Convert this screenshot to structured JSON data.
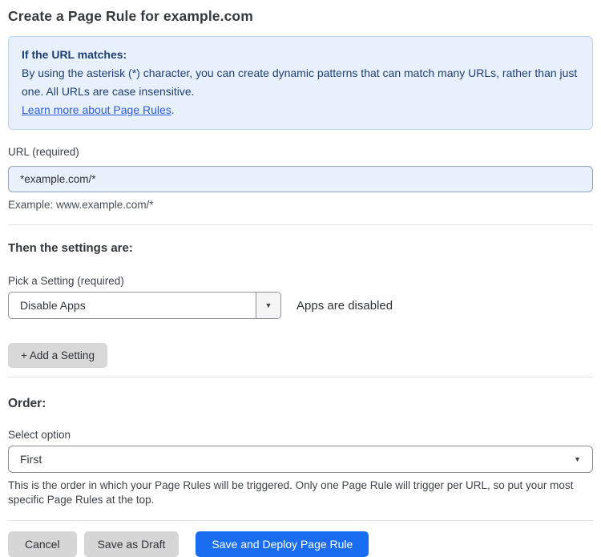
{
  "page": {
    "title": "Create a Page Rule for example.com"
  },
  "info_box": {
    "heading": "If the URL matches:",
    "body": "By using the asterisk (*) character, you can create dynamic patterns that can match many URLs, rather than just one. All URLs are case insensitive.",
    "link": "Learn more about Page Rules",
    "link_suffix": "."
  },
  "url_field": {
    "label": "URL (required)",
    "value": "*example.com/*",
    "helper": "Example: www.example.com/*"
  },
  "settings_section": {
    "heading": "Then the settings are:",
    "setting_label": "Pick a Setting (required)",
    "setting_value": "Disable Apps",
    "setting_status": "Apps are disabled",
    "add_button_label": "+ Add a Setting",
    "caret_glyph": "▼"
  },
  "order_section": {
    "heading": "Order:",
    "label": "Select option",
    "value": "First",
    "caret_glyph": "▼",
    "helper": "This is the order in which your Page Rules will be triggered. Only one Page Rule will trigger per URL, so put your most specific Page Rules at the top."
  },
  "footer": {
    "cancel_label": "Cancel",
    "save_draft_label": "Save as Draft",
    "save_deploy_label": "Save and Deploy Page Rule"
  },
  "colors": {
    "accent_blue": "#1a6cf0",
    "info_background": "#e8f1fb",
    "info_border": "#b9d4f0",
    "info_text": "#1d3f72",
    "link_blue": "#2b5cd9",
    "input_background": "#e8f1fc",
    "gray_button": "#d6d6d6"
  }
}
